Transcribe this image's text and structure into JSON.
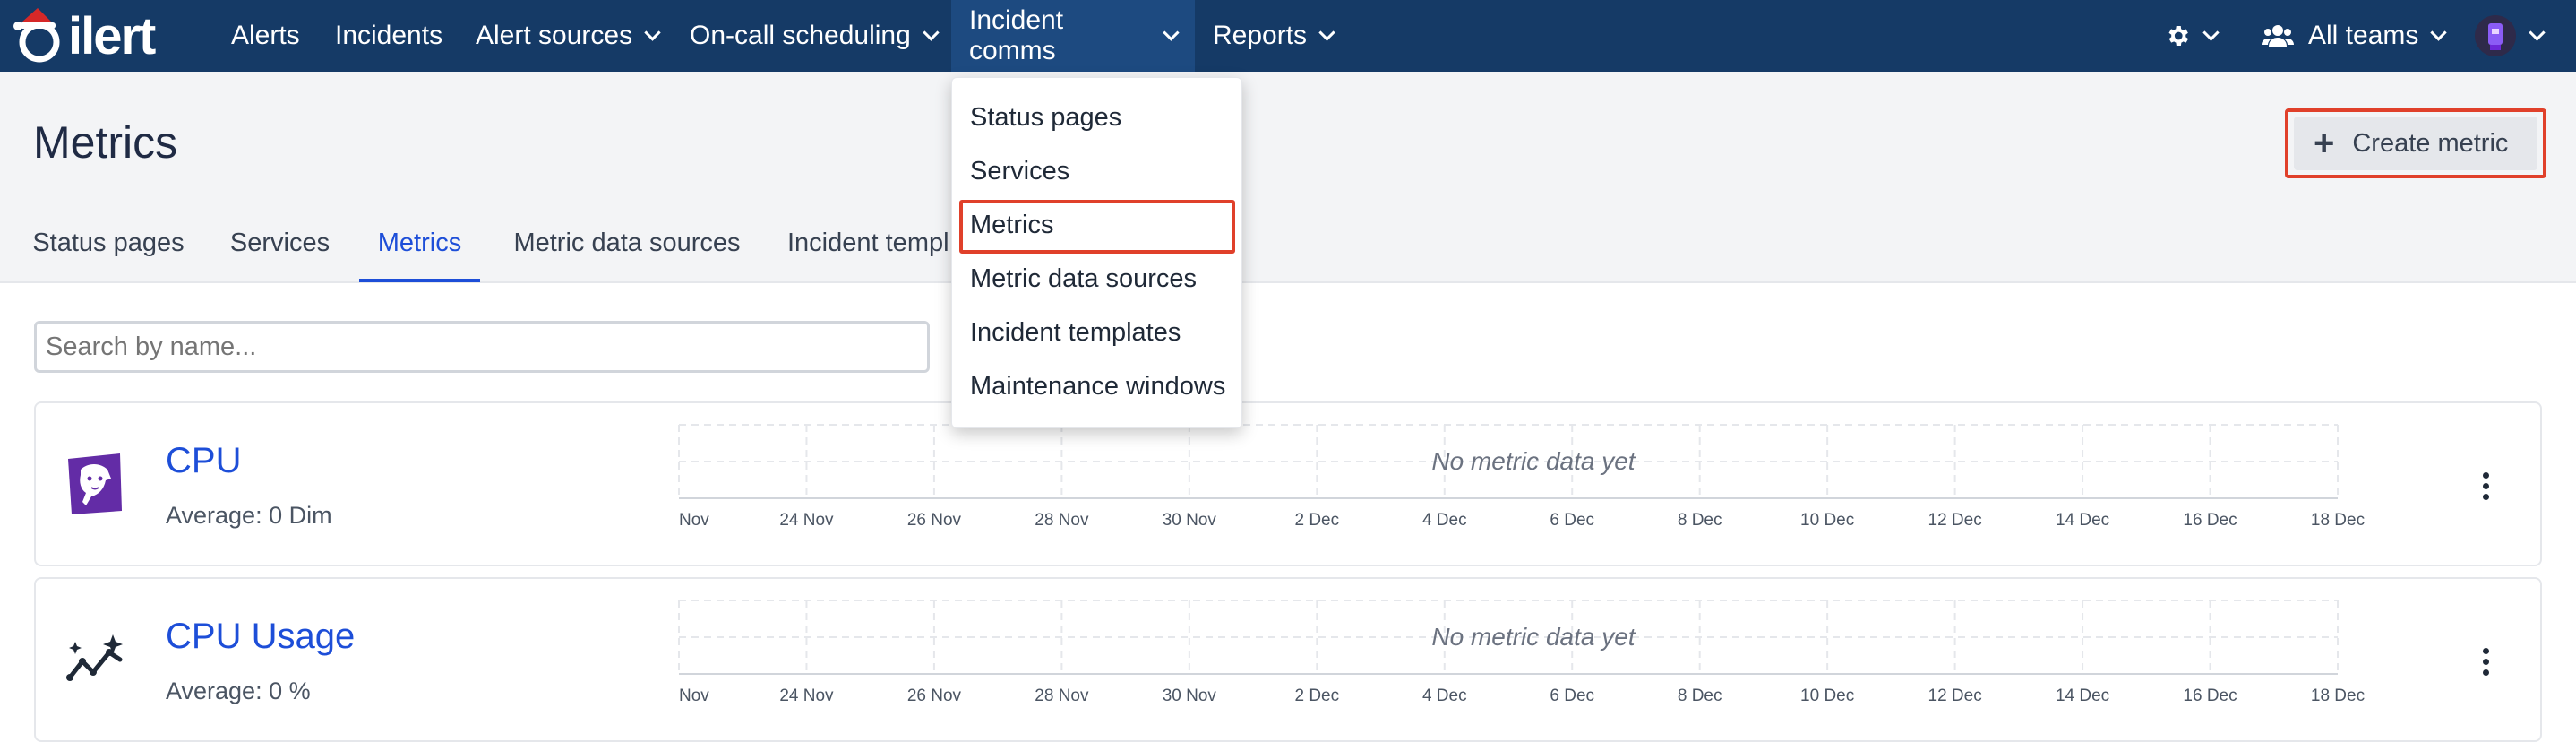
{
  "nav": {
    "logo_text": "ilert",
    "items": [
      {
        "label": "Alerts"
      },
      {
        "label": "Incidents"
      },
      {
        "label": "Alert sources"
      },
      {
        "label": "On-call scheduling"
      },
      {
        "label": "Incident comms"
      },
      {
        "label": "Reports"
      }
    ],
    "teams_label": "All teams"
  },
  "page": {
    "title": "Metrics",
    "create_button": "Create metric",
    "tabs": [
      {
        "label": "Status pages"
      },
      {
        "label": "Services"
      },
      {
        "label": "Metrics"
      },
      {
        "label": "Metric data sources"
      },
      {
        "label": "Incident templ"
      }
    ],
    "search_placeholder": "Search by name..."
  },
  "dropdown": {
    "items": [
      {
        "label": "Status pages"
      },
      {
        "label": "Services"
      },
      {
        "label": "Metrics"
      },
      {
        "label": "Metric data sources"
      },
      {
        "label": "Incident templates"
      },
      {
        "label": "Maintenance windows"
      }
    ]
  },
  "metrics": [
    {
      "name": "CPU",
      "average": "Average: 0 Dim",
      "icon": "datadog-icon"
    },
    {
      "name": "CPU Usage",
      "average": "Average: 0 %",
      "icon": "sparkle-chart-icon"
    }
  ],
  "chart": {
    "empty_text": "No metric data yet",
    "x_ticks": [
      "Nov",
      "24 Nov",
      "26 Nov",
      "28 Nov",
      "30 Nov",
      "2 Dec",
      "4 Dec",
      "6 Dec",
      "8 Dec",
      "10 Dec",
      "12 Dec",
      "14 Dec",
      "16 Dec",
      "18 Dec"
    ]
  },
  "colors": {
    "nav_bg": "#153a66",
    "accent": "#1d4ed8",
    "highlight": "#e0402a"
  }
}
